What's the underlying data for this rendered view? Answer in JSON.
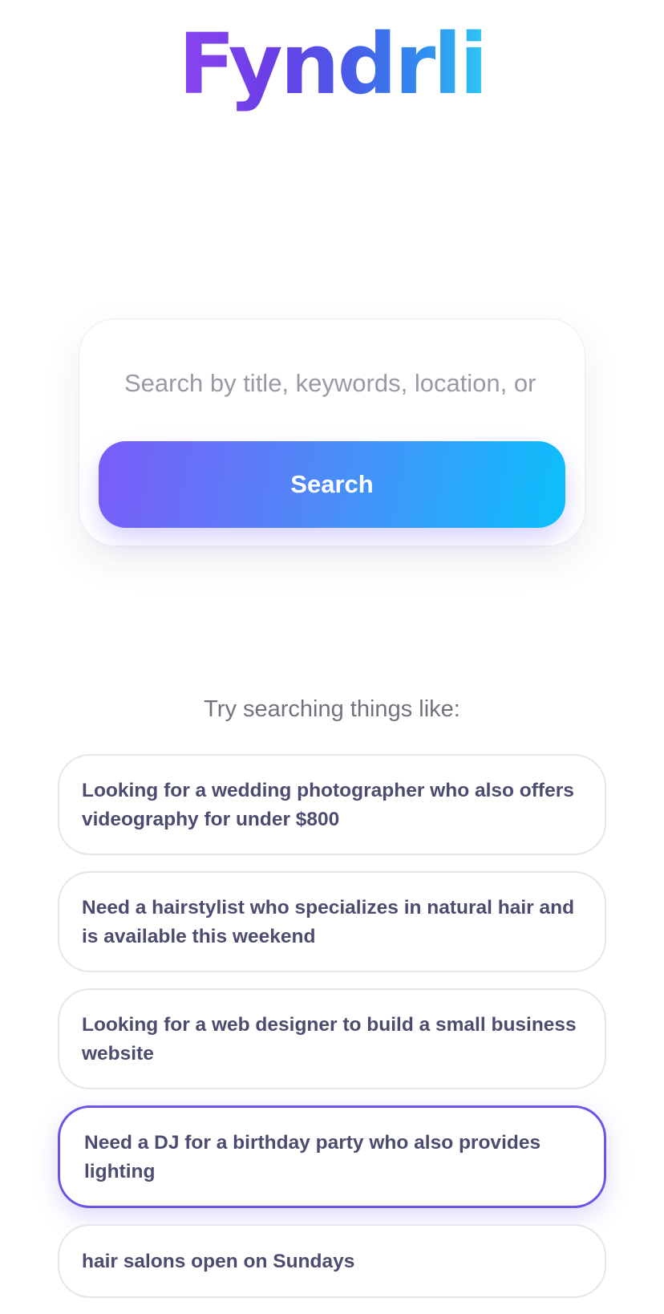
{
  "brand": {
    "name": "Fyndrli",
    "gradient": [
      "#8b45f0",
      "#4a5ae8",
      "#2ec8f2"
    ]
  },
  "search": {
    "placeholder": "Search by title, keywords, location, or category",
    "value": "",
    "button_label": "Search",
    "button_gradient": [
      "#7a5cf8",
      "#0bc0fc"
    ]
  },
  "suggestions": {
    "heading": "Try searching things like:",
    "items": [
      "Looking for a wedding photographer who also offers videography for under $800",
      "Need a hairstylist who specializes in natural hair and is available this weekend",
      "Looking for a web designer to build a small business website",
      "Need a DJ for a birthday party who also provides lighting",
      "hair salons open on Sundays"
    ],
    "selected_index": 3,
    "selected_border_color": "#6a55e6"
  }
}
